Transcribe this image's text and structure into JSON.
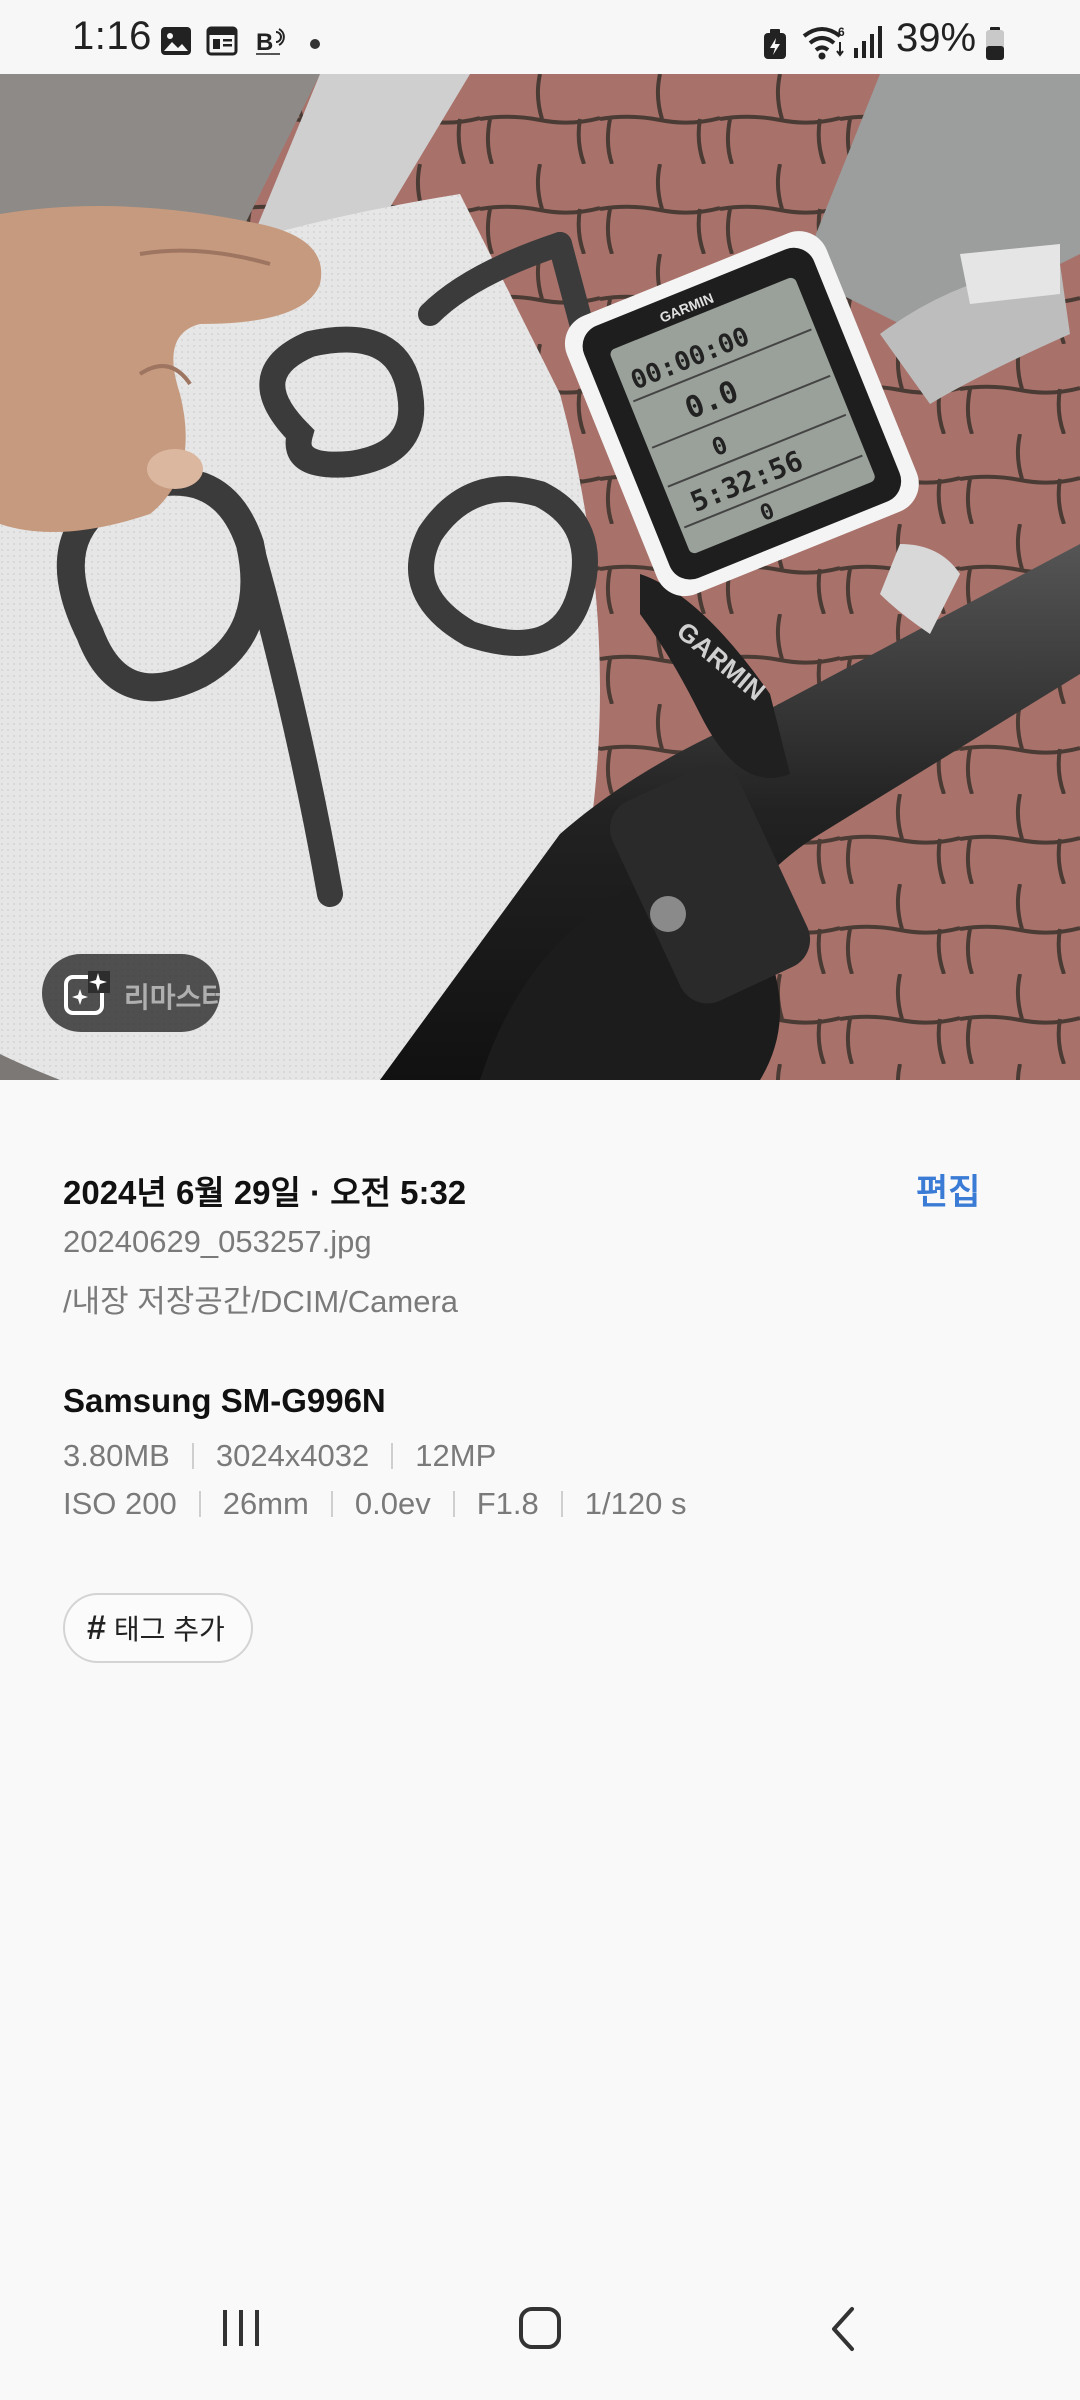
{
  "status_bar": {
    "time": "1:16",
    "battery_percent": "39%",
    "network_label": "6",
    "left_icons": [
      "gallery-icon",
      "calendar-icon",
      "b-app-icon"
    ],
    "right_icons": [
      "battery-saver-icon",
      "wifi-icon",
      "signal-icon",
      "battery-icon"
    ]
  },
  "photo": {
    "remaster_label": "리마스터"
  },
  "details": {
    "date_time": "2024년 6월 29일 · 오전 5:32",
    "edit_label": "편집",
    "file_name": "20240629_053257.jpg",
    "file_path": "/내장 저장공간/DCIM/Camera",
    "device": "Samsung SM-G996N",
    "meta_row1": [
      "3.80MB",
      "3024x4032",
      "12MP"
    ],
    "meta_row2": [
      "ISO 200",
      "26mm",
      "0.0ev",
      "F1.8",
      "1/120 s"
    ],
    "tag_label": "태그 추가"
  },
  "colors": {
    "accent": "#3a7bd5",
    "background": "#f9f9f9",
    "secondary_text": "#7a7a7a"
  },
  "nav_bar": {
    "buttons": [
      "recents-icon",
      "home-icon",
      "back-icon"
    ]
  }
}
